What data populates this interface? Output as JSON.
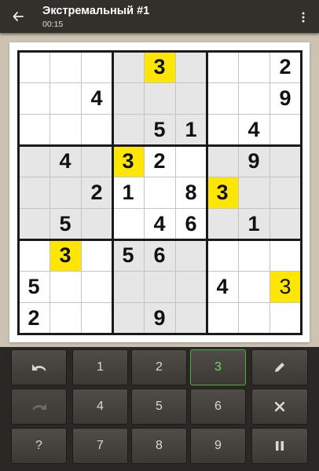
{
  "header": {
    "title": "Экстремальный #1",
    "timer": "00:15",
    "back_icon": "back-arrow-icon",
    "menu_icon": "more-vert-icon"
  },
  "board": {
    "cells": [
      [
        "",
        "",
        "",
        "",
        "3",
        "",
        "",
        "",
        "2"
      ],
      [
        "",
        "",
        "4",
        "",
        "",
        "",
        "",
        "",
        "9"
      ],
      [
        "",
        "",
        "",
        "",
        "5",
        "1",
        "",
        "4",
        ""
      ],
      [
        "",
        "4",
        "",
        "3",
        "2",
        "",
        "",
        "9",
        ""
      ],
      [
        "",
        "",
        "2",
        "1",
        "",
        "8",
        "3",
        "",
        ""
      ],
      [
        "",
        "5",
        "",
        "",
        "4",
        "6",
        "",
        "1",
        ""
      ],
      [
        "",
        "3",
        "",
        "5",
        "6",
        "",
        "",
        "",
        ""
      ],
      [
        "5",
        "",
        "",
        "",
        "",
        "",
        "4",
        "",
        "3"
      ],
      [
        "2",
        "",
        "",
        "",
        "9",
        "",
        "",
        "",
        ""
      ]
    ],
    "highlighted": [
      [
        0,
        4
      ],
      [
        3,
        3
      ],
      [
        4,
        6
      ],
      [
        6,
        1
      ],
      [
        7,
        8
      ]
    ],
    "user_entered": [
      [
        7,
        8
      ]
    ],
    "colors": {
      "highlight": "#ffe600",
      "shade": "#e6e6e6",
      "active_key": "#48b23c"
    }
  },
  "keypad": {
    "undo_icon": "undo-icon",
    "redo_icon": "redo-icon",
    "pencil_icon": "pencil-icon",
    "erase_icon": "erase-icon",
    "hint_label": "?",
    "pause_icon": "pause-icon",
    "digits": [
      "1",
      "2",
      "3",
      "4",
      "5",
      "6",
      "7",
      "8",
      "9"
    ],
    "selected_digit": "3"
  }
}
